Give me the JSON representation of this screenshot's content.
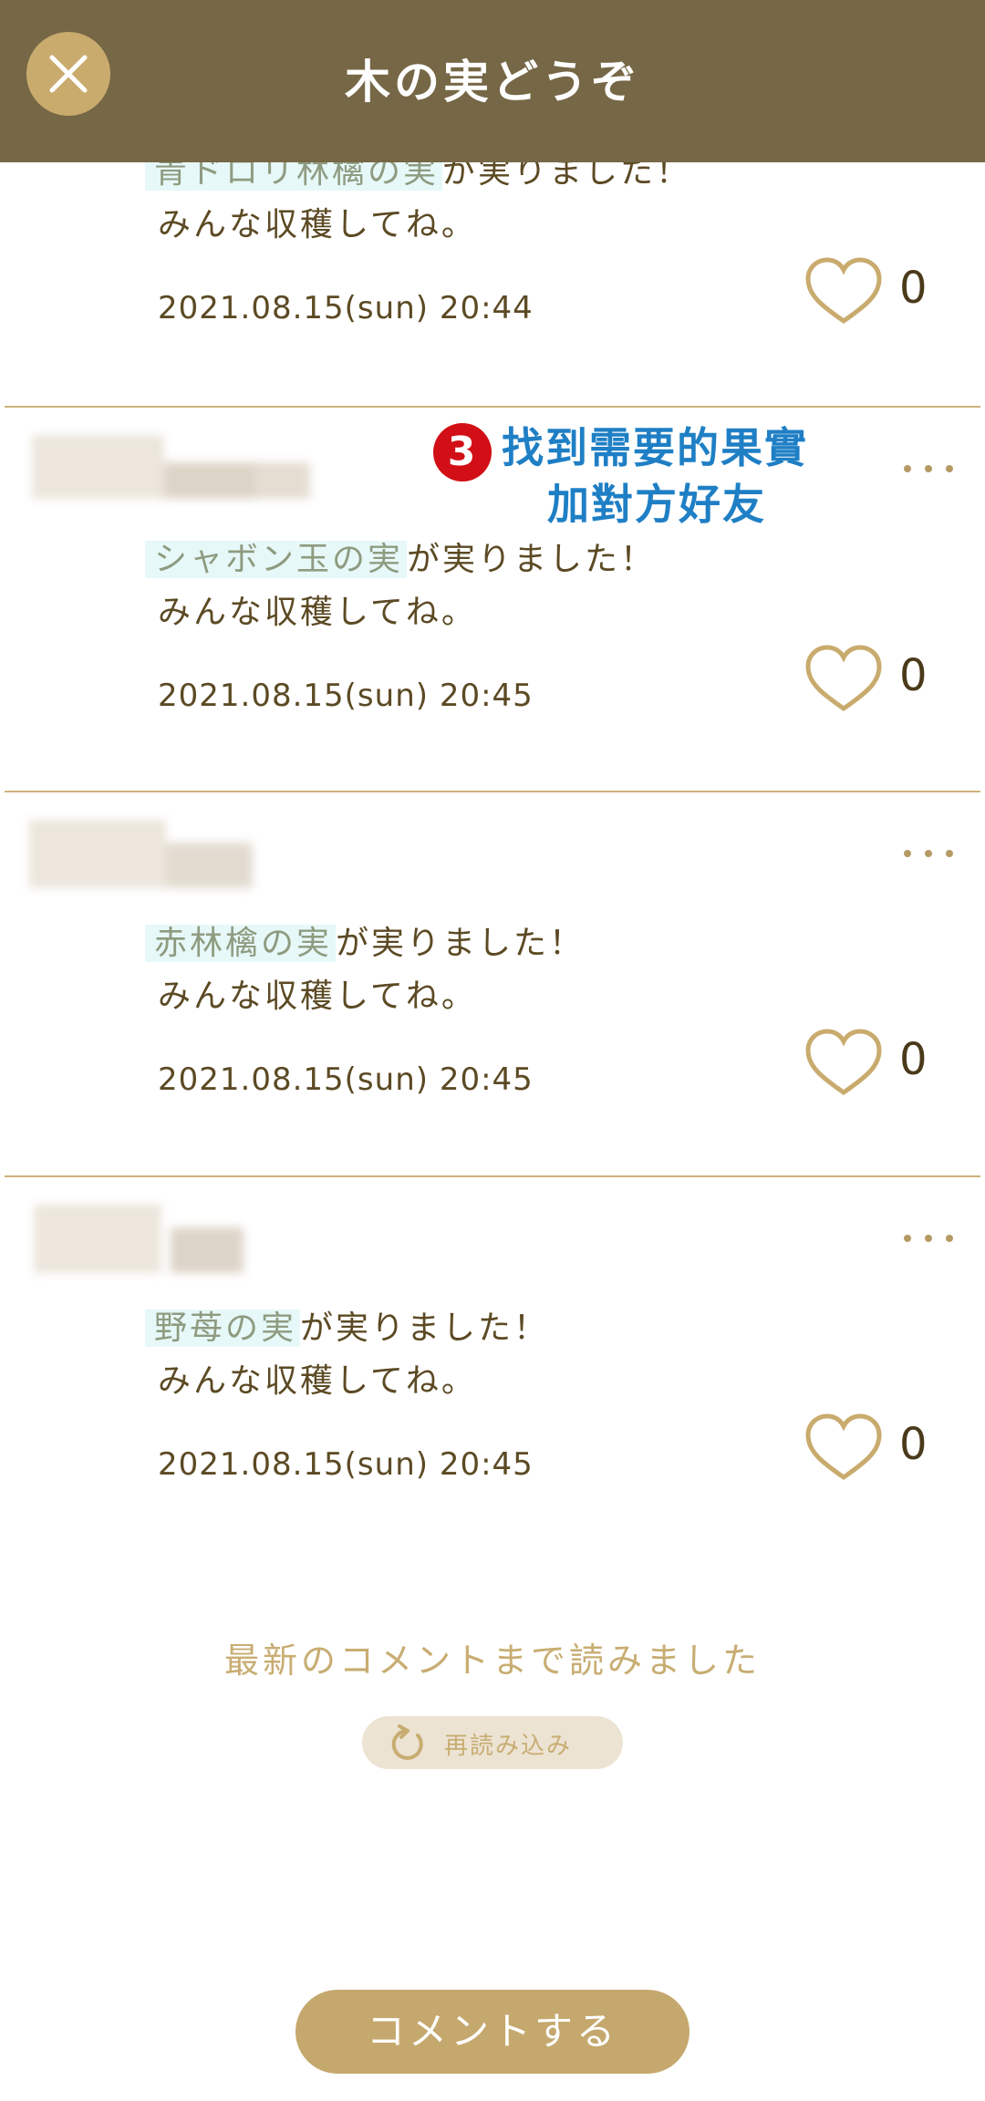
{
  "header": {
    "title": "木の実どうぞ"
  },
  "posts": [
    {
      "fruit": "青ドロリ林檎の実",
      "rest": "が実りました！",
      "line2": "みんな収穫してね。",
      "date": "2021.08.15(sun) 20:44",
      "likes": "0"
    },
    {
      "fruit": "シャボン玉の実",
      "rest": "が実りました！",
      "line2": "みんな収穫してね。",
      "date": "2021.08.15(sun) 20:45",
      "likes": "0"
    },
    {
      "fruit": "赤林檎の実",
      "rest": "が実りました！",
      "line2": "みんな収穫してね。",
      "date": "2021.08.15(sun) 20:45",
      "likes": "0"
    },
    {
      "fruit": "野苺の実",
      "rest": "が実りました！",
      "line2": "みんな収穫してね。",
      "date": "2021.08.15(sun) 20:45",
      "likes": "0"
    }
  ],
  "annotation": {
    "badge": "3",
    "line1": "找到需要的果實",
    "line2": "加對方好友"
  },
  "footer": {
    "end_text": "最新のコメントまで読みました",
    "reload_label": "再読み込み",
    "comment_button": "コメントする"
  },
  "colors": {
    "header": "#766746",
    "accent": "#c5a86d",
    "fruit_text": "#8f9b80",
    "fruit_highlight": "#e6f8f8",
    "annotation": "#1f7fc5"
  }
}
